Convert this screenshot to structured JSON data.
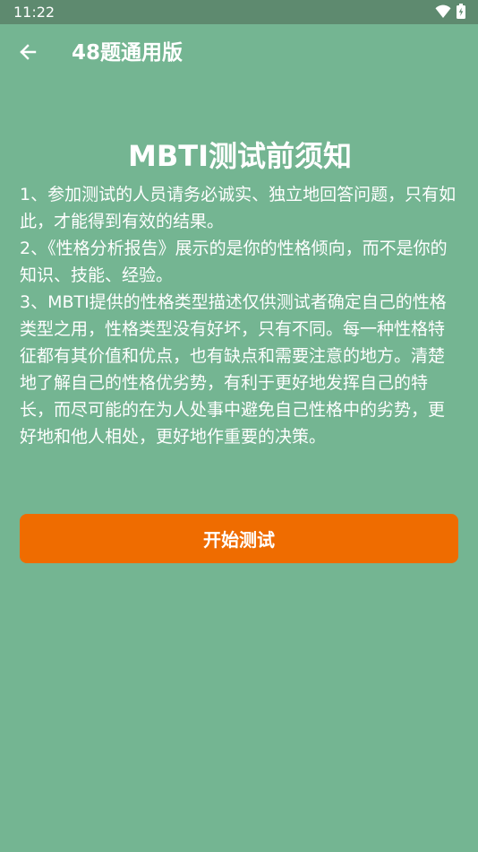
{
  "status_bar": {
    "time": "11:22",
    "icons": [
      "wifi-icon",
      "battery-charging-icon"
    ]
  },
  "app_bar": {
    "back_icon": "arrow-left-icon",
    "title": "48题通用版"
  },
  "main": {
    "heading": "MBTI测试前须知",
    "paragraphs": [
      "1、参加测试的人员请务必诚实、独立地回答问题，只有如此，才能得到有效的结果。",
      "2、《性格分析报告》展示的是你的性格倾向，而不是你的知识、技能、经验。",
      "3、MBTI提供的性格类型描述仅供测试者确定自己的性格类型之用，性格类型没有好坏，只有不同。每一种性格特征都有其价值和优点，也有缺点和需要注意的地方。清楚地了解自己的性格优劣势，有利于更好地发挥自己的特长，而尽可能的在为人处事中避免自己性格中的劣势，更好地和他人相处，更好地作重要的决策。"
    ],
    "start_button_label": "开始测试"
  },
  "colors": {
    "background": "#74b592",
    "status_bar": "#5e8a6f",
    "accent_button": "#ef6c00",
    "text": "#ffffff"
  }
}
